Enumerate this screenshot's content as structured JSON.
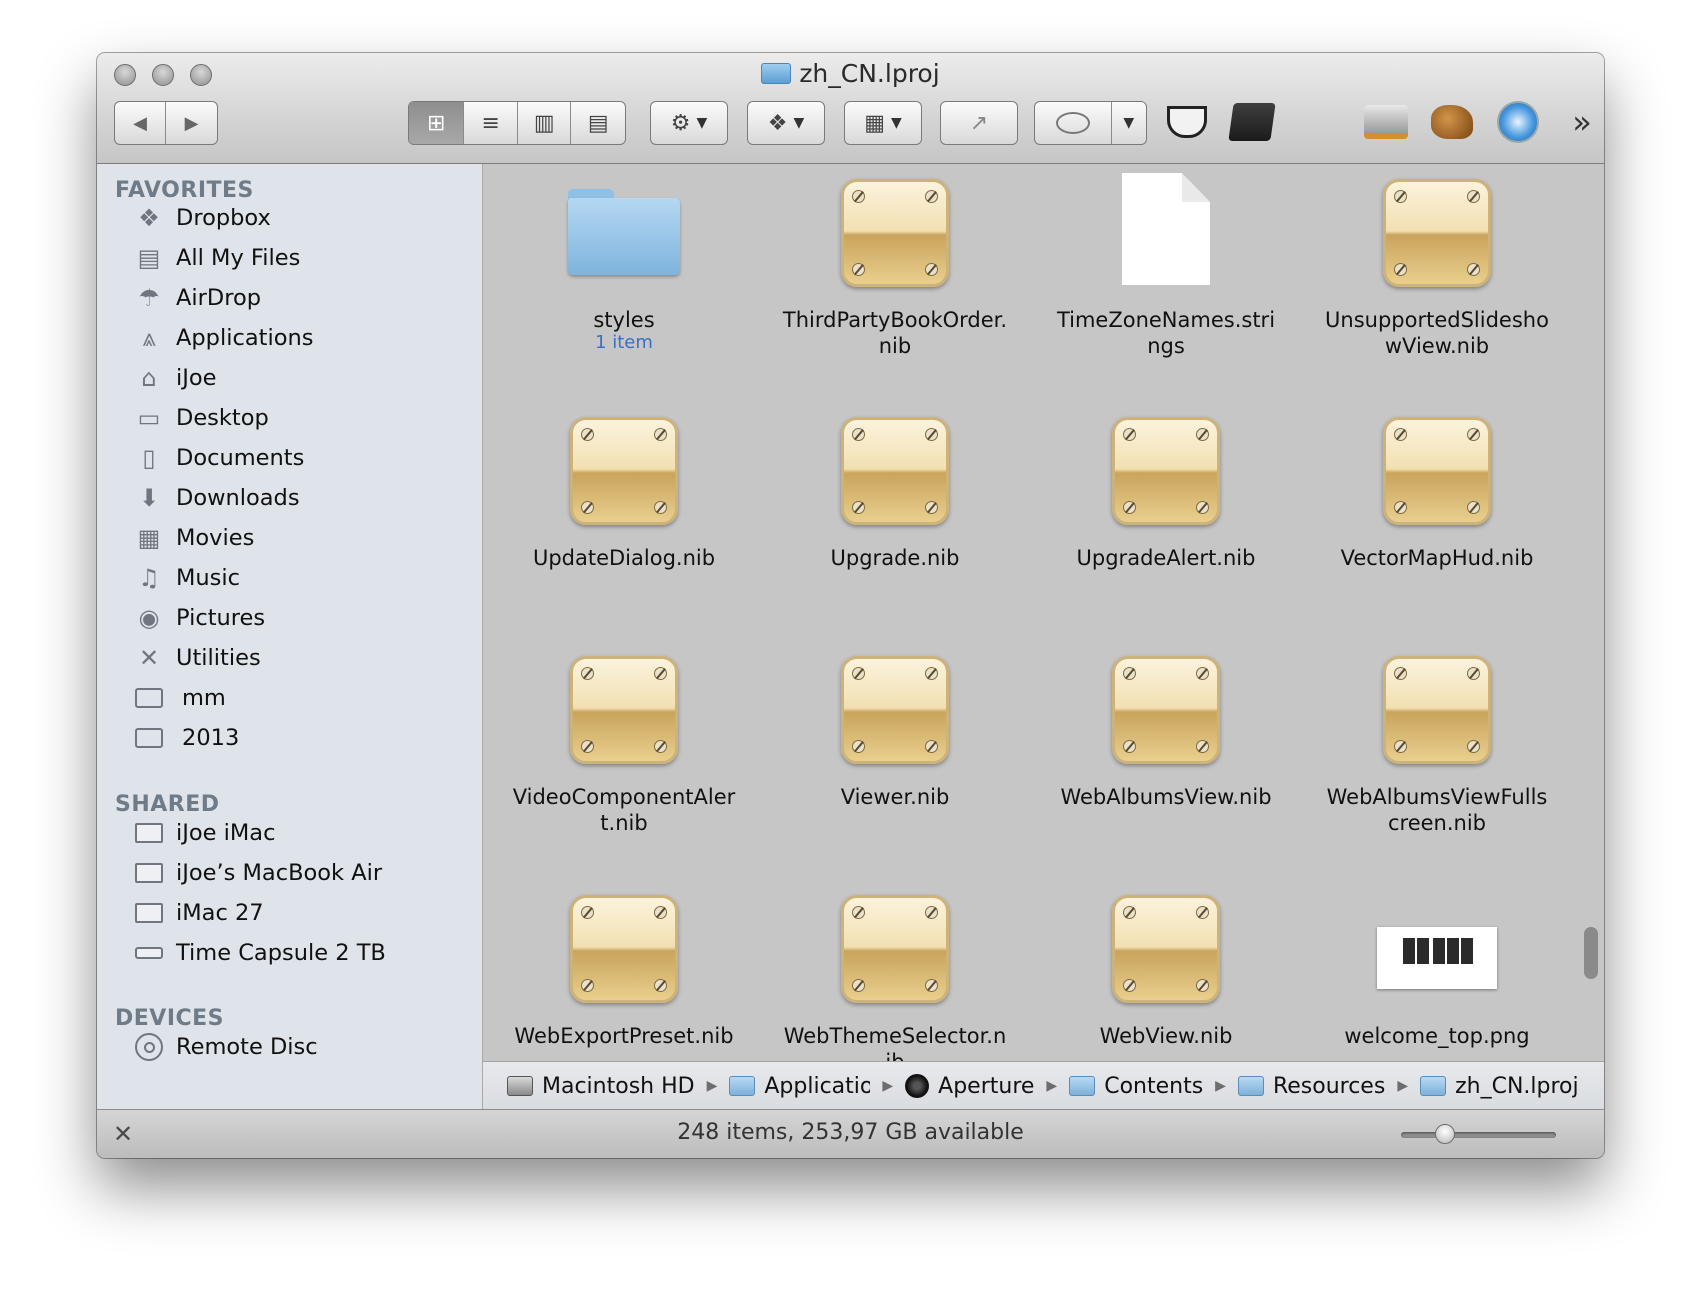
{
  "window": {
    "title": "zh_CN.lproj"
  },
  "toolbar": {
    "back_icon": "◀",
    "forward_icon": "▶",
    "view_icons": [
      "⊞",
      "≡",
      "▥",
      "▤"
    ],
    "action_icon": "⚙",
    "dropbox_icon": "❖",
    "arrange_icon": "▦",
    "share_icon": "↗",
    "overflow_icon": "»"
  },
  "sidebar": {
    "favorites_header": "FAVORITES",
    "favorites": [
      {
        "label": "Dropbox",
        "icon": "❖"
      },
      {
        "label": "All My Files",
        "icon": "▤"
      },
      {
        "label": "AirDrop",
        "icon": "☂"
      },
      {
        "label": "Applications",
        "icon": "⩓"
      },
      {
        "label": "iJoe",
        "icon": "⌂"
      },
      {
        "label": "Desktop",
        "icon": "▭"
      },
      {
        "label": "Documents",
        "icon": "▯"
      },
      {
        "label": "Downloads",
        "icon": "⬇"
      },
      {
        "label": "Movies",
        "icon": "▦"
      },
      {
        "label": "Music",
        "icon": "♫"
      },
      {
        "label": "Pictures",
        "icon": "◉"
      },
      {
        "label": "Utilities",
        "icon": "✕"
      },
      {
        "label": "mm",
        "icon": "folder"
      },
      {
        "label": "2013",
        "icon": "folder"
      }
    ],
    "shared_header": "SHARED",
    "shared": [
      "iJoe iMac",
      "iJoe’s MacBook Air",
      "iMac 27",
      "Time Capsule 2 TB"
    ],
    "devices_header": "DEVICES",
    "devices": [
      "Remote Disc"
    ]
  },
  "files": [
    {
      "name": "styles",
      "sub": "1 item",
      "kind": "folder"
    },
    {
      "name": "ThirdPartyBookOrder.nib",
      "kind": "nib"
    },
    {
      "name": "TimeZoneNames.strings",
      "kind": "doc"
    },
    {
      "name": "UnsupportedSlideshowView.nib",
      "kind": "nib"
    },
    {
      "name": "UpdateDialog.nib",
      "kind": "nib"
    },
    {
      "name": "Upgrade.nib",
      "kind": "nib"
    },
    {
      "name": "UpgradeAlert.nib",
      "kind": "nib"
    },
    {
      "name": "VectorMapHud.nib",
      "kind": "nib"
    },
    {
      "name": "VideoComponentAlert.nib",
      "kind": "nib"
    },
    {
      "name": "Viewer.nib",
      "kind": "nib"
    },
    {
      "name": "WebAlbumsView.nib",
      "kind": "nib"
    },
    {
      "name": "WebAlbumsViewFullscreen.nib",
      "kind": "nib"
    },
    {
      "name": "WebExportPreset.nib",
      "kind": "nib"
    },
    {
      "name": "WebThemeSelector.nib",
      "kind": "nib"
    },
    {
      "name": "WebView.nib",
      "kind": "nib"
    },
    {
      "name": "welcome_top.png",
      "kind": "png"
    }
  ],
  "pathbar": [
    {
      "label": "Macintosh HD",
      "icon": "disk-icon"
    },
    {
      "label": "Applicatior",
      "icon": "applications-folder-icon"
    },
    {
      "label": "Aperture",
      "icon": "aperture-app-icon"
    },
    {
      "label": "Contents",
      "icon": "folder-icon"
    },
    {
      "label": "Resources",
      "icon": "folder-icon"
    },
    {
      "label": "zh_CN.lproj",
      "icon": "folder-icon"
    }
  ],
  "status": {
    "text": "248 items, 253,97 GB available",
    "icon_size_level": 0.25
  }
}
